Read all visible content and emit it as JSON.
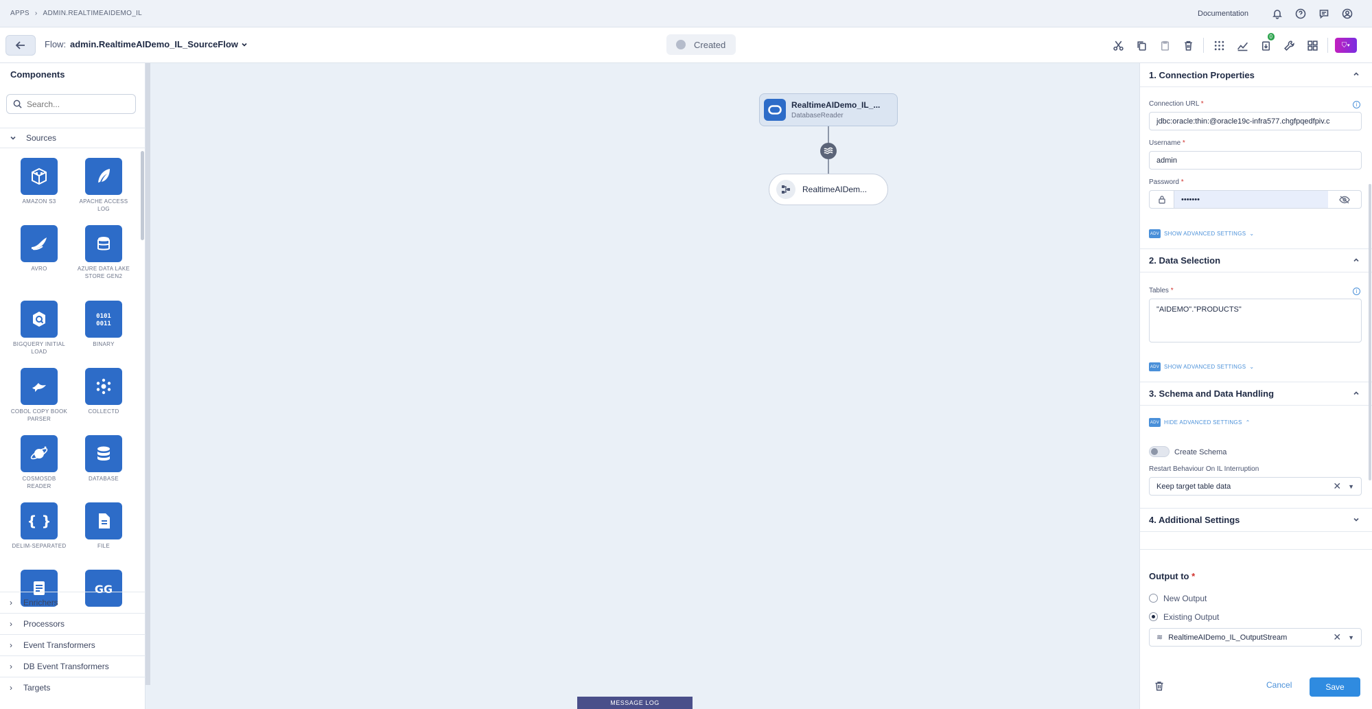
{
  "topbar": {
    "crumbs": [
      "APPS",
      "ADMIN.REALTIMEAIDEMO_IL"
    ],
    "documentation": "Documentation",
    "icons": [
      "bell-icon",
      "help-icon",
      "chat-icon",
      "user-icon"
    ]
  },
  "flowbar": {
    "flow_label": "Flow:",
    "flow_name": "admin.RealtimeAIDemo_IL_SourceFlow",
    "status": "Created",
    "badge_count": "0"
  },
  "sidebar": {
    "title": "Components",
    "search_placeholder": "Search...",
    "sources_label": "Sources",
    "components": [
      {
        "label": "AMAZON S3",
        "icon": "cube-icon"
      },
      {
        "label": "APACHE ACCESS LOG",
        "icon": "feather-icon"
      },
      {
        "label": "AVRO",
        "icon": "wing-icon"
      },
      {
        "label": "AZURE DATA LAKE STORE GEN2",
        "icon": "storage-icon"
      },
      {
        "label": "BIGQUERY INITIAL LOAD",
        "icon": "bigquery-icon"
      },
      {
        "label": "BINARY",
        "icon": "binary-icon"
      },
      {
        "label": "COBOL COPY BOOK PARSER",
        "icon": "bird-icon"
      },
      {
        "label": "COLLECTD",
        "icon": "dots-icon"
      },
      {
        "label": "COSMOSDB READER",
        "icon": "planet-icon"
      },
      {
        "label": "DATABASE",
        "icon": "database-icon"
      },
      {
        "label": "DELIM-SEPARATED",
        "icon": "braces-icon"
      },
      {
        "label": "FILE",
        "icon": "file-icon"
      },
      {
        "label": "",
        "icon": "document-icon"
      },
      {
        "label": "",
        "icon": "gg-icon"
      }
    ],
    "categories": [
      "Enrichers",
      "Processors",
      "Event Transformers",
      "DB Event Transformers",
      "Targets"
    ]
  },
  "canvas": {
    "source_node": {
      "title": "RealtimeAIDemo_IL_...",
      "subtitle": "DatabaseReader"
    },
    "stream_node": {
      "title": "RealtimeAIDem..."
    },
    "message_log": "MESSAGE LOG"
  },
  "panel": {
    "section1": "1. Connection Properties",
    "connection_url_label": "Connection URL",
    "connection_url": "jdbc:oracle:thin:@oracle19c-infra577.chgfpqedfpiv.c",
    "username_label": "Username",
    "username": "admin",
    "password_label": "Password",
    "password": "•••••••",
    "show_advanced": "SHOW ADVANCED SETTINGS",
    "advanced_tag": "ADV",
    "section2": "2. Data Selection",
    "tables_label": "Tables",
    "tables_value": "\"AIDEMO\".\"PRODUCTS\"",
    "show_advanced2": "SHOW ADVANCED SETTINGS",
    "section3": "3. Schema and Data Handling",
    "hide_advanced": "HIDE ADVANCED SETTINGS",
    "create_schema": "Create Schema",
    "restart_label": "Restart Behaviour On IL Interruption",
    "restart_value": "Keep target table data",
    "section4": "4. Additional Settings",
    "output_to": "Output to",
    "new_output": "New Output",
    "existing_output": "Existing Output",
    "output_value": "RealtimeAIDemo_IL_OutputStream",
    "cancel": "Cancel",
    "save": "Save"
  },
  "colors": {
    "accent": "#2d6cc8",
    "primary_button": "#2f8be0",
    "brand": "#c21fbe"
  }
}
